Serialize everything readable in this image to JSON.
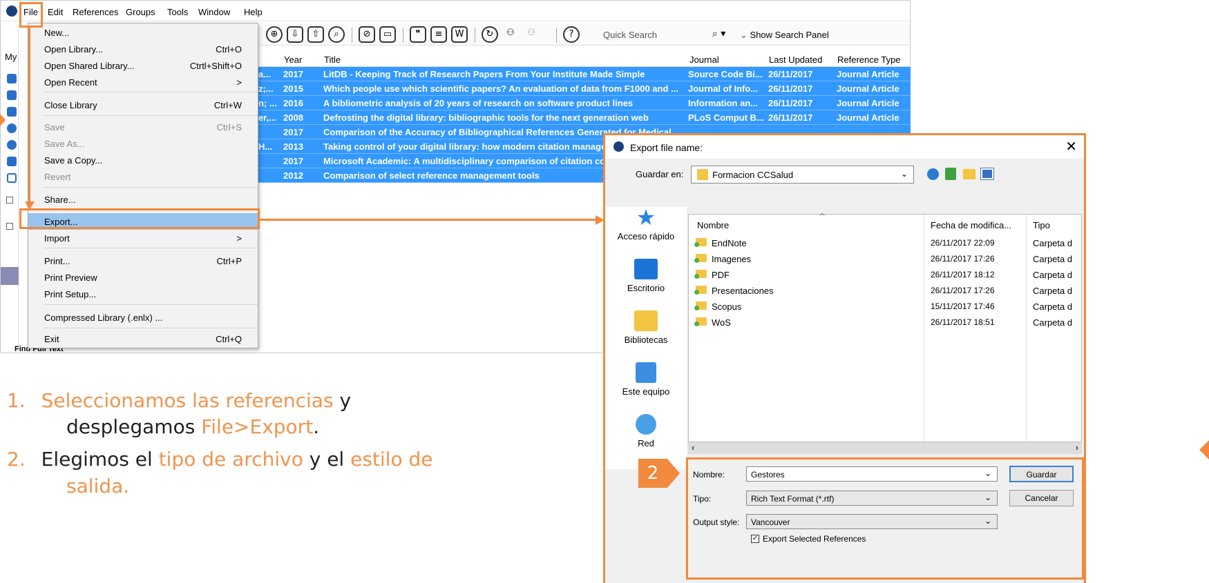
{
  "menubar": {
    "items": [
      "File",
      "Edit",
      "References",
      "Groups",
      "Tools",
      "Window",
      "Help"
    ]
  },
  "toolbar": {
    "quick_search": "Quick Search",
    "show_search_panel": "Show Search Panel"
  },
  "left_strip": {
    "my_label": "My",
    "find_full_text": "Find Full Text"
  },
  "table": {
    "headers": [
      "Year",
      "Title",
      "Journal",
      "Last Updated",
      "Reference Type"
    ],
    "rows": [
      {
        "author": "a...",
        "year": "2017",
        "title": "LitDB - Keeping Track of Research Papers From Your Institute Made Simple",
        "journal": "Source Code Bi...",
        "updated": "26/11/2017",
        "type": "Journal Article"
      },
      {
        "author": "z;...",
        "year": "2015",
        "title": "Which people use which scientific papers? An evaluation of data from F1000 and ...",
        "journal": "Journal of Info...",
        "updated": "26/11/2017",
        "type": "Journal Article"
      },
      {
        "author": "n; ...",
        "year": "2016",
        "title": "A bibliometric analysis of 20 years of research on software product lines",
        "journal": "Information an...",
        "updated": "26/11/2017",
        "type": "Journal Article"
      },
      {
        "author": "er,...",
        "year": "2008",
        "title": "Defrosting the digital library: bibliographic tools for the next generation web",
        "journal": "PLoS Comput B...",
        "updated": "26/11/2017",
        "type": "Journal Article"
      },
      {
        "author": "",
        "year": "2017",
        "title": "Comparison of the Accuracy of Bibliographical References Generated for Medical",
        "journal": "",
        "updated": "",
        "type": ""
      },
      {
        "author": "H...",
        "year": "2013",
        "title": "Taking control of your digital library: how modern citation manage",
        "journal": "",
        "updated": "",
        "type": ""
      },
      {
        "author": "",
        "year": "2017",
        "title": "Microsoft Academic: A multidisciplinary comparison of citation cou",
        "journal": "",
        "updated": "",
        "type": ""
      },
      {
        "author": "",
        "year": "2012",
        "title": "Comparison of select reference management tools",
        "journal": "",
        "updated": "",
        "type": ""
      }
    ]
  },
  "file_menu": {
    "items": [
      {
        "label": "New...",
        "shortcut": ""
      },
      {
        "label": "Open Library...",
        "shortcut": "Ctrl+O"
      },
      {
        "label": "Open Shared Library...",
        "shortcut": "Ctrtl+Shift+O"
      },
      {
        "label": "Open Recent",
        "shortcut": ">"
      },
      {
        "label": "Close Library",
        "shortcut": "Ctrl+W"
      },
      {
        "label": "Save",
        "shortcut": "Ctrl+S"
      },
      {
        "label": "Save As...",
        "shortcut": ""
      },
      {
        "label": "Save a Copy...",
        "shortcut": ""
      },
      {
        "label": "Revert",
        "shortcut": ""
      },
      {
        "label": "Share...",
        "shortcut": ""
      },
      {
        "label": "Export...",
        "shortcut": ""
      },
      {
        "label": "Import",
        "shortcut": ">"
      },
      {
        "label": "Print...",
        "shortcut": "Ctrl+P"
      },
      {
        "label": "Print Preview",
        "shortcut": ""
      },
      {
        "label": "Print Setup...",
        "shortcut": ""
      },
      {
        "label": "Compressed Library (.enlx) ...",
        "shortcut": ""
      },
      {
        "label": "Exit",
        "shortcut": "Ctrl+Q"
      }
    ]
  },
  "dialog": {
    "title": "Export file name:",
    "save_in_label": "Guardar en:",
    "save_in_value": "Formacion CCSalud",
    "places": [
      "Acceso rápido",
      "Escritorio",
      "Bibliotecas",
      "Este equipo",
      "Red"
    ],
    "columns": [
      "Nombre",
      "Fecha de modifica...",
      "Tipo"
    ],
    "files": [
      {
        "name": "EndNote",
        "date": "26/11/2017 22:09",
        "type": "Carpeta d"
      },
      {
        "name": "Imagenes",
        "date": "26/11/2017 17:26",
        "type": "Carpeta d"
      },
      {
        "name": "PDF",
        "date": "26/11/2017 18:12",
        "type": "Carpeta d"
      },
      {
        "name": "Presentaciones",
        "date": "26/11/2017 17:26",
        "type": "Carpeta d"
      },
      {
        "name": "Scopus",
        "date": "15/11/2017 17:46",
        "type": "Carpeta d"
      },
      {
        "name": "WoS",
        "date": "26/11/2017 18:51",
        "type": "Carpeta d"
      }
    ],
    "name_label": "Nombre:",
    "name_value": "Gestores",
    "type_label": "Tipo:",
    "type_value": "Rich Text Format (*.rtf)",
    "style_label": "Output style:",
    "style_value": "Vancouver",
    "export_selected": "Export Selected References",
    "save_button": "Guardar",
    "cancel_button": "Cancelar"
  },
  "badge": "2",
  "steps": {
    "s1_num": "1.",
    "s1_a": "Seleccionamos las referencias",
    "s1_b": " y",
    "s1_c": "desplegamos ",
    "s1_d": "File>Export",
    "s1_e": ".",
    "s2_num": "2.",
    "s2_a": "Elegimos el ",
    "s2_b": "tipo de archivo",
    "s2_c": " y el ",
    "s2_d": "estilo de",
    "s2_e": "salida."
  },
  "colors": {
    "accent": "#f2893c",
    "selection": "#3399ff",
    "menu_highlight": "#99c4ee"
  }
}
